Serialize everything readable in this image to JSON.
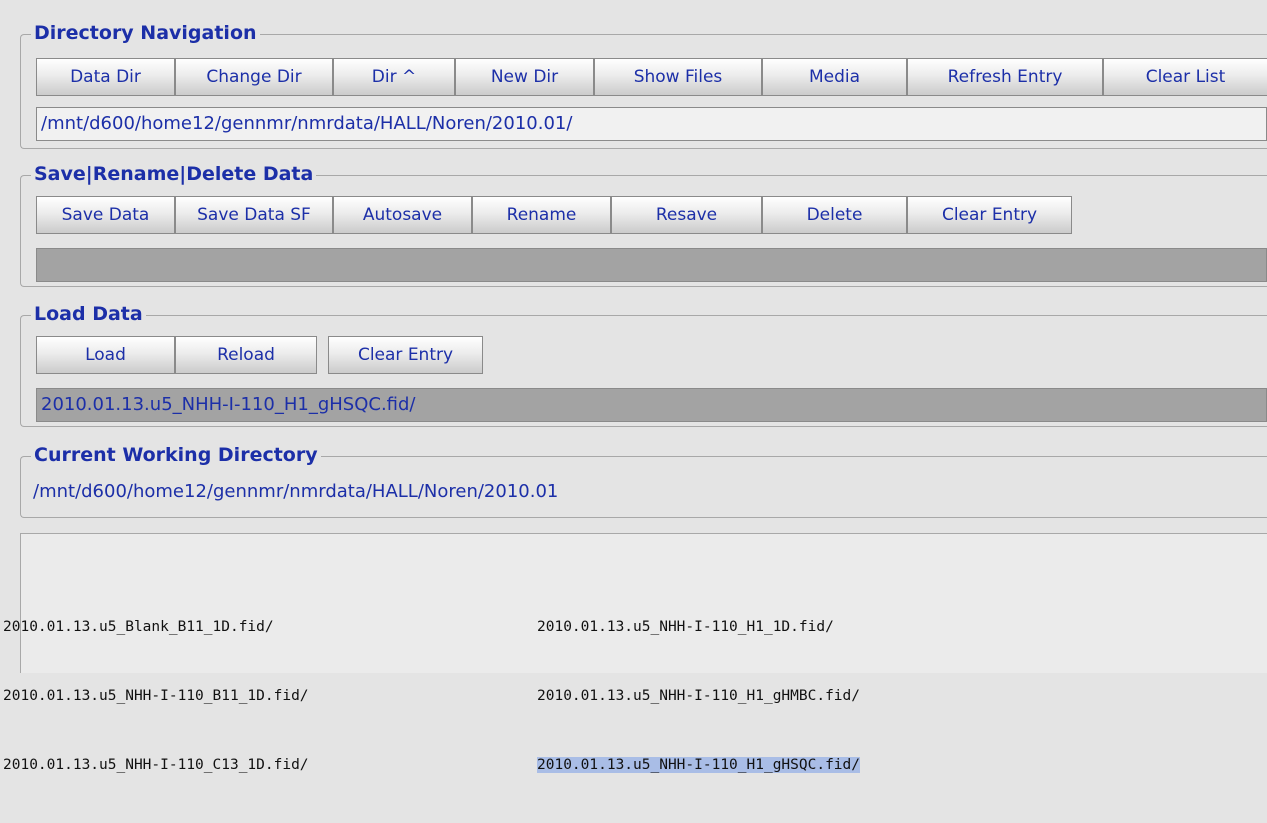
{
  "directory_navigation": {
    "title": "Directory Navigation",
    "buttons": [
      "Data Dir",
      "Change Dir",
      "Dir ^",
      "New Dir",
      "Show Files",
      "Media",
      "Refresh Entry",
      "Clear List"
    ],
    "path": "/mnt/d600/home12/gennmr/nmrdata/HALL/Noren/2010.01/"
  },
  "save_rename_delete": {
    "title": "Save|Rename|Delete Data",
    "buttons": [
      "Save Data",
      "Save Data SF",
      "Autosave",
      "Rename",
      "Resave",
      "Delete",
      "Clear Entry"
    ],
    "entry": ""
  },
  "load_data": {
    "title": "Load Data",
    "buttons": [
      "Load",
      "Reload",
      "Clear Entry"
    ],
    "entry": "2010.01.13.u5_NHH-I-110_H1_gHSQC.fid/"
  },
  "current_working_directory": {
    "title": "Current Working Directory",
    "path": "/mnt/d600/home12/gennmr/nmrdata/HALL/Noren/2010.01"
  },
  "files": {
    "column1": [
      "2010.01.13.u5_Blank_B11_1D.fid/",
      "2010.01.13.u5_NHH-I-110_B11_1D.fid/",
      "2010.01.13.u5_NHH-I-110_C13_1D.fid/"
    ],
    "column2": [
      "2010.01.13.u5_NHH-I-110_H1_1D.fid/",
      "2010.01.13.u5_NHH-I-110_H1_gHMBC.fid/",
      "2010.01.13.u5_NHH-I-110_H1_gHSQC.fid/"
    ],
    "selected": "2010.01.13.u5_NHH-I-110_H1_gHSQC.fid/"
  },
  "colors": {
    "label_blue": "#1c2fa8",
    "selection": "#a9bde6",
    "background": "#e4e4e4"
  }
}
